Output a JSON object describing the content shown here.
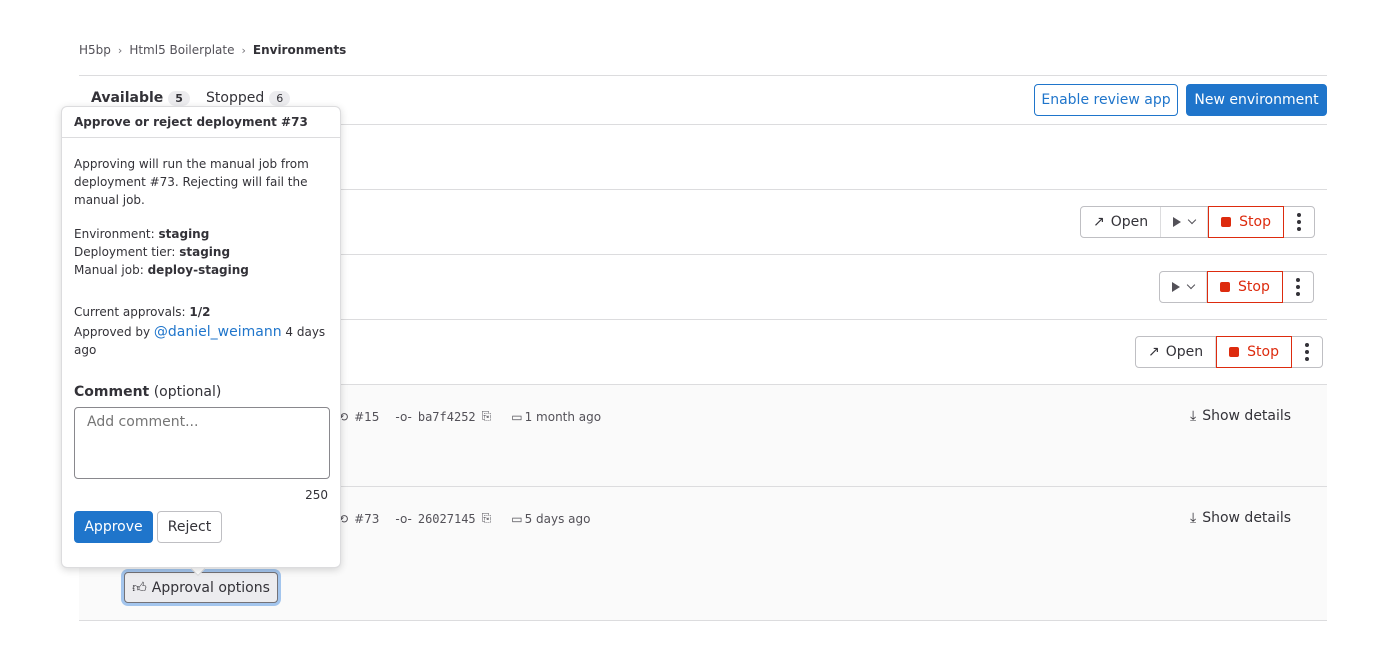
{
  "breadcrumb": [
    "H5bp",
    "Html5 Boilerplate",
    "Environments"
  ],
  "tabs": [
    {
      "label": "Available",
      "count": "5"
    },
    {
      "label": "Stopped",
      "count": "6"
    }
  ],
  "header_buttons": {
    "enable_review_app": "Enable review app",
    "new_environment": "New environment"
  },
  "rows": [
    {
      "open": "Open",
      "stop": "Stop"
    },
    {
      "stop": "Stop"
    },
    {
      "open": "Open",
      "stop": "Stop"
    }
  ],
  "deployments": [
    {
      "pipeline": "#15",
      "commit": "ba7f4252",
      "time": "1 month ago",
      "show_details": "Show details"
    },
    {
      "pipeline": "#73",
      "commit": "26027145",
      "time": "5 days ago",
      "show_details": "Show details"
    }
  ],
  "popover": {
    "title": "Approve or reject deployment #73",
    "description": "Approving will run the manual job from deployment #73. Rejecting will fail the manual job.",
    "environment_label": "Environment:",
    "environment": "staging",
    "tier_label": "Deployment tier:",
    "tier": "staging",
    "job_label": "Manual job:",
    "job": "deploy-staging",
    "approvals_label": "Current approvals:",
    "approvals": "1/2",
    "approved_by_label": "Approved by",
    "approved_by_user": "@daniel_weimann",
    "approved_when": "4 days ago",
    "comment_label": "Comment",
    "comment_optional": "(optional)",
    "comment_placeholder": "Add comment...",
    "char_count": "250",
    "approve": "Approve",
    "reject": "Reject"
  },
  "approval_options": "Approval options",
  "colors": {
    "primary": "#1f75cb",
    "danger": "#dd2b0e"
  }
}
